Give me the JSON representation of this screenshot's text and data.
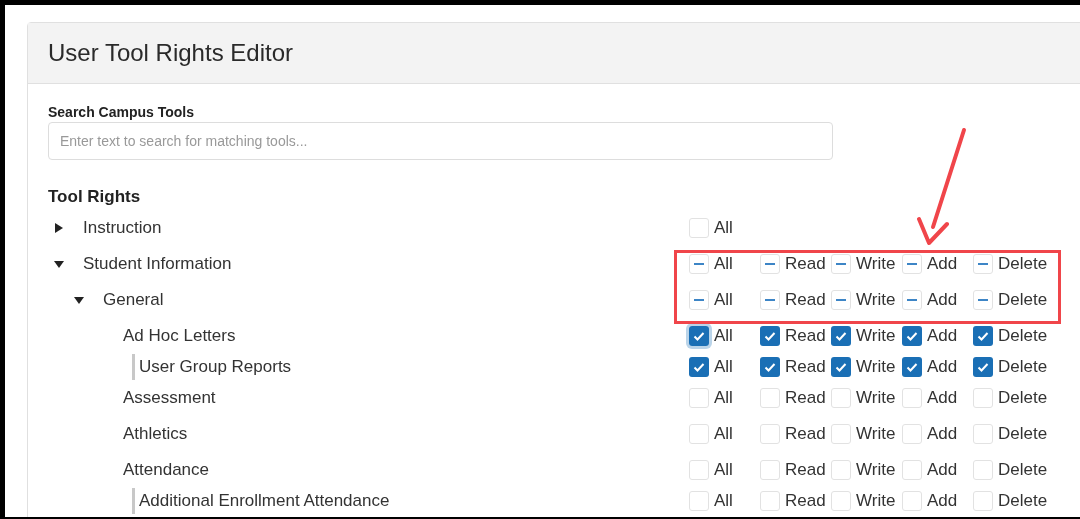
{
  "title": "User Tool Rights Editor",
  "search": {
    "label": "Search Campus Tools",
    "placeholder": "Enter text to search for matching tools..."
  },
  "section_title": "Tool Rights",
  "tree": [
    {
      "label": "Instruction",
      "expanded": false,
      "partial": false,
      "rights": [
        {
          "label": "All",
          "checked": false,
          "focused": false
        }
      ]
    },
    {
      "label": "Student Information",
      "expanded": true,
      "partial": true,
      "rights": [
        {
          "label": "All"
        },
        {
          "label": "Read"
        },
        {
          "label": "Write"
        },
        {
          "label": "Add"
        },
        {
          "label": "Delete"
        }
      ],
      "children": [
        {
          "label": "General",
          "expanded": true,
          "partial": true,
          "rights": [
            {
              "label": "All"
            },
            {
              "label": "Read"
            },
            {
              "label": "Write"
            },
            {
              "label": "Add"
            },
            {
              "label": "Delete"
            }
          ],
          "children": [
            {
              "label": "Ad Hoc Letters",
              "partial": false,
              "rights": [
                {
                  "label": "All",
                  "checked": true,
                  "focused": true
                },
                {
                  "label": "Read",
                  "checked": true,
                  "focused": false
                },
                {
                  "label": "Write",
                  "checked": true,
                  "focused": false
                },
                {
                  "label": "Add",
                  "checked": true,
                  "focused": false
                },
                {
                  "label": "Delete",
                  "checked": true,
                  "focused": false
                }
              ],
              "children": [
                {
                  "label": "User Group Reports",
                  "partial": false,
                  "rights": [
                    {
                      "label": "All",
                      "checked": true,
                      "focused": false
                    },
                    {
                      "label": "Read",
                      "checked": true,
                      "focused": false
                    },
                    {
                      "label": "Write",
                      "checked": true,
                      "focused": false
                    },
                    {
                      "label": "Add",
                      "checked": true,
                      "focused": false
                    },
                    {
                      "label": "Delete",
                      "checked": true,
                      "focused": false
                    }
                  ]
                }
              ]
            },
            {
              "label": "Assessment",
              "partial": false,
              "rights": [
                {
                  "label": "All",
                  "checked": false,
                  "focused": false
                },
                {
                  "label": "Read",
                  "checked": false,
                  "focused": false
                },
                {
                  "label": "Write",
                  "checked": false,
                  "focused": false
                },
                {
                  "label": "Add",
                  "checked": false,
                  "focused": false
                },
                {
                  "label": "Delete",
                  "checked": false,
                  "focused": false
                }
              ]
            },
            {
              "label": "Athletics",
              "partial": false,
              "rights": [
                {
                  "label": "All",
                  "checked": false,
                  "focused": false
                },
                {
                  "label": "Read",
                  "checked": false,
                  "focused": false
                },
                {
                  "label": "Write",
                  "checked": false,
                  "focused": false
                },
                {
                  "label": "Add",
                  "checked": false,
                  "focused": false
                },
                {
                  "label": "Delete",
                  "checked": false,
                  "focused": false
                }
              ]
            },
            {
              "label": "Attendance",
              "partial": false,
              "rights": [
                {
                  "label": "All",
                  "checked": false,
                  "focused": false
                },
                {
                  "label": "Read",
                  "checked": false,
                  "focused": false
                },
                {
                  "label": "Write",
                  "checked": false,
                  "focused": false
                },
                {
                  "label": "Add",
                  "checked": false,
                  "focused": false
                },
                {
                  "label": "Delete",
                  "checked": false,
                  "focused": false
                }
              ],
              "children": [
                {
                  "label": "Additional Enrollment Attendance",
                  "partial": false,
                  "rights": [
                    {
                      "label": "All",
                      "checked": false,
                      "focused": false
                    },
                    {
                      "label": "Read",
                      "checked": false,
                      "focused": false
                    },
                    {
                      "label": "Write",
                      "checked": false,
                      "focused": false
                    },
                    {
                      "label": "Add",
                      "checked": false,
                      "focused": false
                    },
                    {
                      "label": "Delete",
                      "checked": false,
                      "focused": false
                    }
                  ]
                }
              ]
            }
          ]
        }
      ]
    }
  ]
}
